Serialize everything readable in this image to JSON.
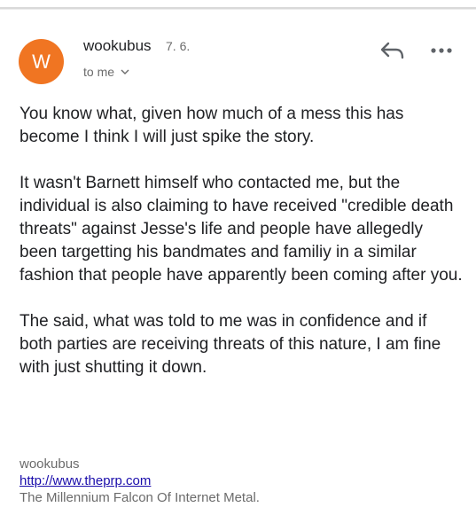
{
  "message": {
    "avatar_letter": "W",
    "sender": "wookubus",
    "date": "7. 6.",
    "recipient_label": "to me",
    "body": [
      "You know what, given how much of a mess this has become I think I will just spike the story.",
      "It wasn't Barnett himself who contacted me, but the individual is also claiming to have received \"credible death threats\" against Jesse's life and people have allegedly been targetting his bandmates and familiy in a similar fashion that people have apparently been coming after you.",
      "The said, what was told to me was in confidence and if both parties are receiving threats of this nature, I am fine with just shutting it down."
    ],
    "signature": {
      "name": "wookubus",
      "url": "http://www.theprp.com",
      "tagline": "The Millennium Falcon Of Internet Metal."
    }
  },
  "icons": {
    "reply": "reply-arrow-icon",
    "more": "more-horizontal-icon",
    "expand": "chevron-down-icon"
  },
  "colors": {
    "avatar": "#f07522",
    "link": "#1a0dab",
    "muted": "#6b6b6b"
  }
}
